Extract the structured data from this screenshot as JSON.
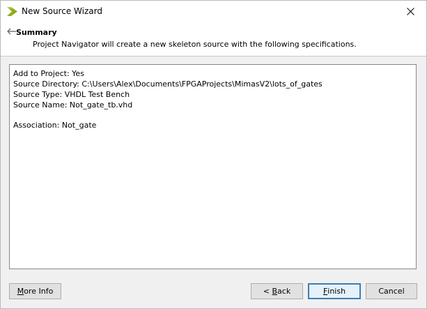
{
  "window": {
    "title": "New Source Wizard",
    "icon": "xilinx-logo-icon",
    "close_icon": "close-icon"
  },
  "header": {
    "back_icon": "arrow-left-icon",
    "title": "Summary",
    "description": "Project Navigator will create a new skeleton source with the following specifications."
  },
  "summary_lines": [
    "Add to Project: Yes",
    "Source Directory: C:\\Users\\Alex\\Documents\\FPGAProjects\\MimasV2\\lots_of_gates",
    "Source Type: VHDL Test Bench",
    "Source Name: Not_gate_tb.vhd",
    "",
    "Association: Not_gate"
  ],
  "buttons": {
    "more_info": {
      "mnemonic": "M",
      "rest": "ore Info"
    },
    "back": {
      "prefix": "< ",
      "mnemonic": "B",
      "rest": "ack"
    },
    "finish": {
      "mnemonic": "F",
      "rest": "inish"
    },
    "cancel": {
      "label": "Cancel"
    }
  },
  "colors": {
    "default_button_border": "#3c7fb1",
    "logo_green": "#8fae1b"
  }
}
